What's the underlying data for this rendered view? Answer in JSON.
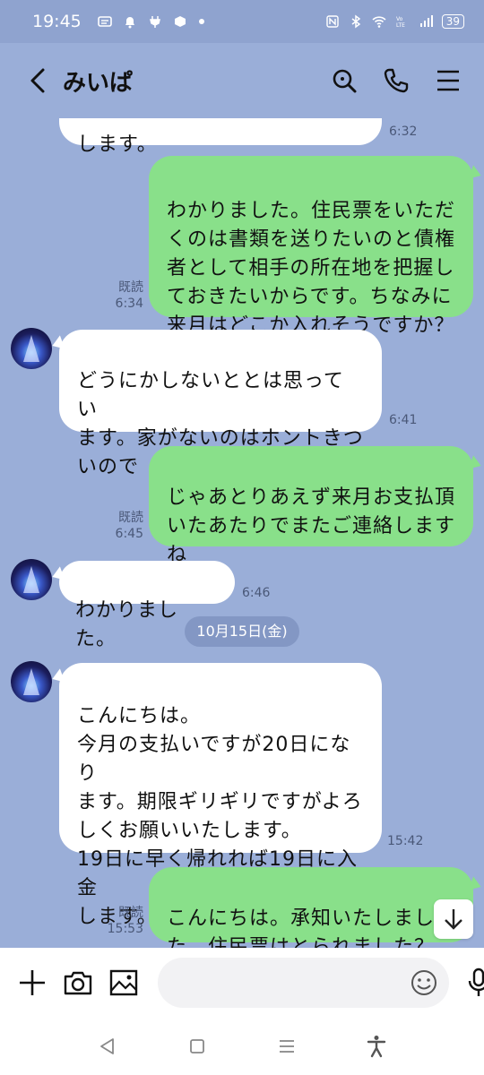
{
  "status_bar": {
    "time": "19:45",
    "battery": "39"
  },
  "header": {
    "title": "みいぱ"
  },
  "colors": {
    "chat_bg": "#9aaed8",
    "outgoing_bubble": "#89e08a",
    "incoming_bubble": "#ffffff"
  },
  "messages": [
    {
      "dir": "in",
      "text": "します。",
      "time": "6:32"
    },
    {
      "dir": "out",
      "text": "わかりました。住民票をいただ\nくのは書類を送りたいのと債権\n者として相手の所在地を把握し\nておきたいからです。ちなみに\n来月はどこか入れそうですか？",
      "read": "既読",
      "time": "6:34"
    },
    {
      "dir": "in",
      "text": "どうにかしないととは思ってい\nます。家がないのはホントきつ\nいので",
      "time": "6:41"
    },
    {
      "dir": "out",
      "text": "じゃあとりあえず来月お支払頂\nいたあたりでまたご連絡します\nね",
      "read": "既読",
      "time": "6:45"
    },
    {
      "dir": "in",
      "text": "わかりました。",
      "time": "6:46"
    },
    {
      "dir": "in",
      "text": "こんにちは。\n今月の支払いですが20日になり\nます。期限ギリギリですがよろ\nしくお願いいたします。\n19日に早く帰れれば19日に入金\nします。",
      "time": "15:42"
    },
    {
      "dir": "out",
      "text": "こんにちは。承知いたしまし\nた。住民票はとられました？",
      "read": "既読",
      "time": "15:53"
    }
  ],
  "date_divider": "10月15日(金)"
}
